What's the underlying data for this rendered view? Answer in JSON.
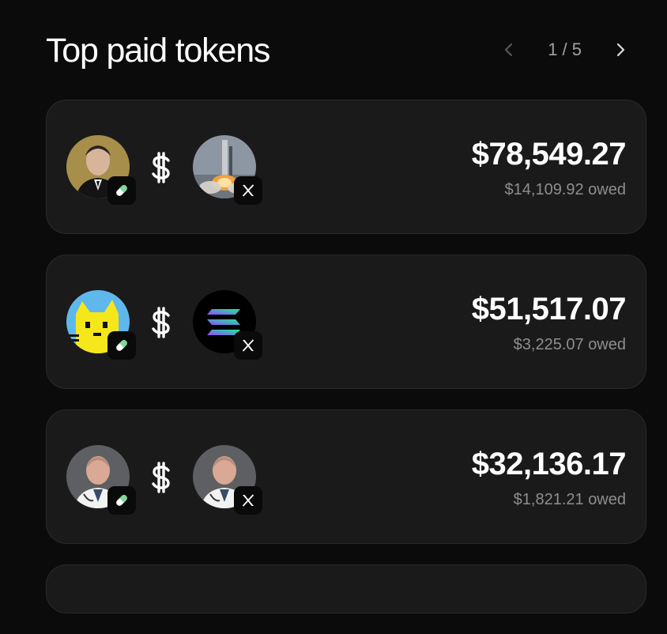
{
  "header": {
    "title": "Top paid tokens",
    "pagination": "1 / 5",
    "prev_icon": "chevron-left-icon",
    "next_icon": "chevron-right-icon"
  },
  "tokens": [
    {
      "amount": "$78,549.27",
      "owed": "$14,109.92 owed",
      "token_avatar": "man-in-suit-portrait",
      "target_avatar": "rocket-launch-photo",
      "token_badge": "pill-icon",
      "target_badge": "x-logo-icon"
    },
    {
      "amount": "$51,517.07",
      "owed": "$3,225.07 owed",
      "token_avatar": "yellow-pixel-cat",
      "target_avatar": "solana-logo",
      "token_badge": "pill-icon",
      "target_badge": "x-logo-icon"
    },
    {
      "amount": "$32,136.17",
      "owed": "$1,821.21 owed",
      "token_avatar": "doctor-portrait",
      "target_avatar": "doctor-portrait",
      "token_badge": "pill-icon",
      "target_badge": "x-logo-icon"
    }
  ],
  "colors": {
    "background": "#0b0b0b",
    "card": "#1a1a1a",
    "card_border": "#2a2a2a",
    "muted_text": "#8e8e8e",
    "pill_green": "#7ed99a"
  }
}
